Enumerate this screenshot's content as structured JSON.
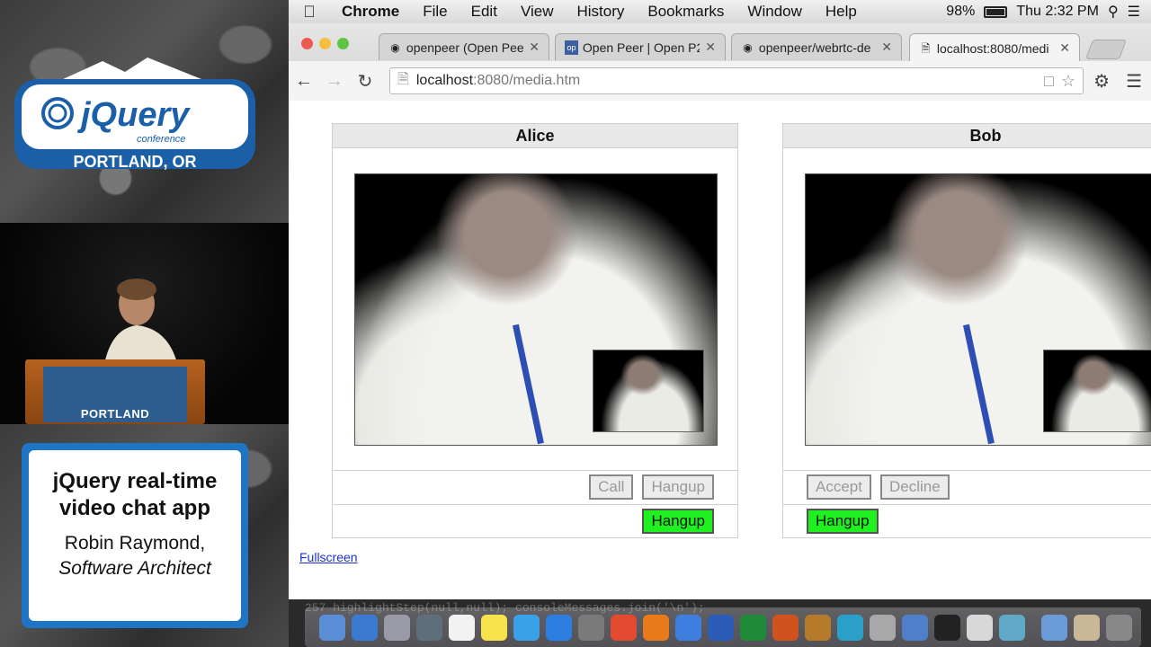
{
  "conference": {
    "logo_name": "jQuery",
    "logo_sub": "conference",
    "logo_location": "PORTLAND, OR",
    "podium_label": "PORTLAND"
  },
  "talk": {
    "title": "jQuery real-time video chat app",
    "speaker": "Robin Raymond,",
    "role": "Software Architect"
  },
  "menubar": {
    "items": [
      "Chrome",
      "File",
      "Edit",
      "View",
      "History",
      "Bookmarks",
      "Window",
      "Help"
    ],
    "battery": "98%",
    "battery_level": 0.98,
    "clock": "Thu 2:32 PM"
  },
  "tabs": [
    {
      "label": "openpeer (Open Peer",
      "icon": "github-icon"
    },
    {
      "label": "Open Peer | Open P2",
      "icon": "openpeer-icon"
    },
    {
      "label": "openpeer/webrtc-de",
      "icon": "github-icon"
    },
    {
      "label": "localhost:8080/medi",
      "icon": "page-icon"
    }
  ],
  "address_bar": {
    "host": "localhost",
    "path": ":8080/media.htm"
  },
  "alice": {
    "title": "Alice",
    "call_label": "Call",
    "hangup_label": "Hangup",
    "active_hangup_label": "Hangup"
  },
  "bob": {
    "title": "Bob",
    "accept_label": "Accept",
    "decline_label": "Decline",
    "active_hangup_label": "Hangup"
  },
  "fullscreen_link": "Fullscreen",
  "terminal_fragment": "257    highlightStep(null,null);   consoleMessages.join('\\n');",
  "colors": {
    "hangup_active": "#1ff01f",
    "title_card_border": "#1f75c4",
    "link": "#1a33d0"
  }
}
